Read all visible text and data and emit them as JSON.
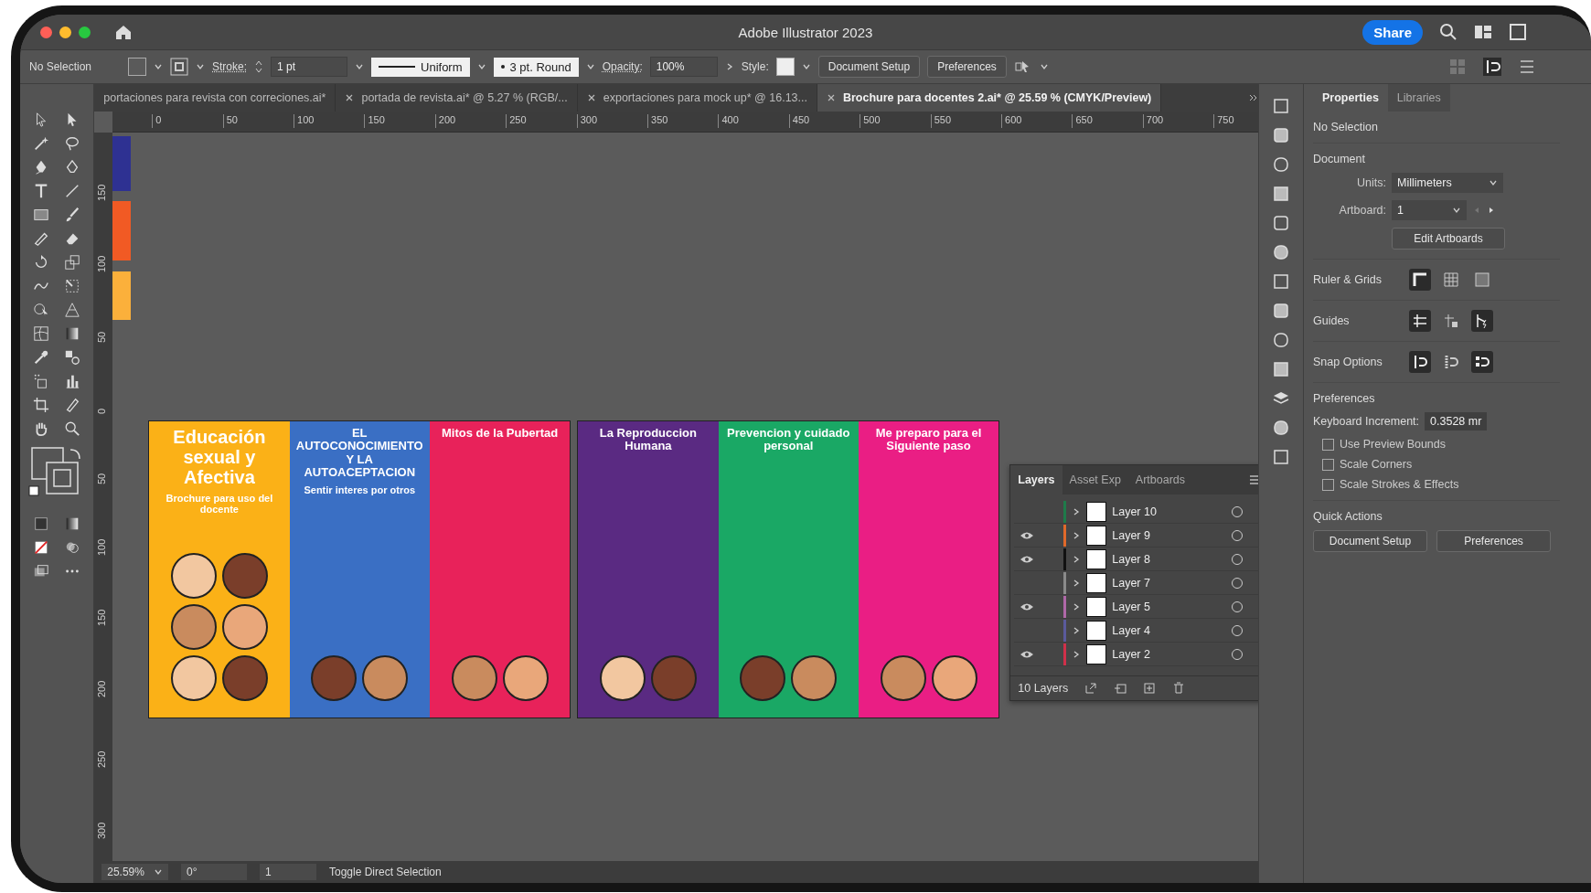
{
  "window": {
    "title": "Adobe Illustrator 2023",
    "share": "Share"
  },
  "control_bar": {
    "selection": "No Selection",
    "stroke_label": "Stroke:",
    "stroke_value": "1 pt",
    "profile": "Uniform",
    "brush": "3 pt. Round",
    "opacity_label": "Opacity:",
    "opacity_value": "100%",
    "style_label": "Style:",
    "buttons": [
      "Document Setup",
      "Preferences"
    ]
  },
  "tabs": [
    {
      "label": "portaciones para revista con correciones.ai*",
      "selected": false
    },
    {
      "label": "portada de revista.ai* @ 5.27 % (RGB/...",
      "selected": false
    },
    {
      "label": "exportaciones para mock up* @ 16.13...",
      "selected": false
    },
    {
      "label": "Brochure para docentes 2.ai* @ 25.59 % (CMYK/Preview)",
      "selected": true
    }
  ],
  "ruler": {
    "h_ticks": [
      "0",
      "50",
      "100",
      "150",
      "200",
      "250",
      "300",
      "350",
      "400",
      "450",
      "500",
      "550",
      "600",
      "650",
      "700",
      "750"
    ],
    "v_ticks": [
      "150",
      "100",
      "50",
      "0",
      "50",
      "100",
      "150",
      "200",
      "250",
      "300"
    ]
  },
  "swatches": [
    {
      "color": "#2e3192"
    },
    {
      "color": "#f15a24"
    },
    {
      "color": "#fbb03b"
    }
  ],
  "artboards": [
    {
      "panels": [
        {
          "color": "#fbb117",
          "title": "Educación sexual y Afectiva",
          "subtitle": "Brochure para uso del docente"
        },
        {
          "color": "#3a6fc4",
          "title": "EL AUTOCONOCIMIENTO Y LA AUTOACEPTACION",
          "subtitle": "Sentir interes por otros"
        },
        {
          "color": "#e8225a",
          "title": "Mitos de la Pubertad"
        }
      ]
    },
    {
      "panels": [
        {
          "color": "#5a2a82",
          "title": "La Reproduccion Humana"
        },
        {
          "color": "#1aa865",
          "title": "Prevencion y cuidado personal"
        },
        {
          "color": "#ea1e84",
          "title": "Me preparo para el Siguiente paso"
        }
      ]
    }
  ],
  "layers_panel": {
    "tabs": [
      {
        "label": "Layers",
        "selected": true
      },
      {
        "label": "Asset Exp",
        "selected": false
      },
      {
        "label": "Artboards",
        "selected": false
      }
    ],
    "items": [
      {
        "name": "Layer 10",
        "visible": false,
        "color": "#1f7a4a"
      },
      {
        "name": "Layer 9",
        "visible": true,
        "color": "#e0692a"
      },
      {
        "name": "Layer 8",
        "visible": true,
        "color": "#111111"
      },
      {
        "name": "Layer 7",
        "visible": false,
        "color": "#8a8a8a"
      },
      {
        "name": "Layer 5",
        "visible": true,
        "color": "#b068a8"
      },
      {
        "name": "Layer 4",
        "visible": false,
        "color": "#5a5a9c"
      },
      {
        "name": "Layer 2",
        "visible": true,
        "color": "#d0304a"
      }
    ],
    "count": "10 Layers"
  },
  "properties": {
    "tabs": [
      {
        "label": "Properties",
        "selected": true
      },
      {
        "label": "Libraries",
        "selected": false
      }
    ],
    "selection": "No Selection",
    "document_heading": "Document",
    "units_label": "Units:",
    "units": "Millimeters",
    "artboard_label": "Artboard:",
    "artboard": "1",
    "edit_artboards": "Edit Artboards",
    "ruler_grids": "Ruler & Grids",
    "guides": "Guides",
    "snap_options": "Snap Options",
    "preferences_heading": "Preferences",
    "keyboard_label": "Keyboard Increment:",
    "keyboard_value": "0.3528 mr",
    "checkboxes": [
      {
        "label": "Use Preview Bounds",
        "checked": false
      },
      {
        "label": "Scale Corners",
        "checked": false
      },
      {
        "label": "Scale Strokes & Effects",
        "checked": false
      }
    ],
    "quick_actions": "Quick Actions",
    "buttons": [
      "Document Setup",
      "Preferences"
    ]
  },
  "status_bar": {
    "zoom": "25.59%",
    "rotation": "0°",
    "artboard": "1",
    "tool": "Toggle Direct Selection"
  }
}
